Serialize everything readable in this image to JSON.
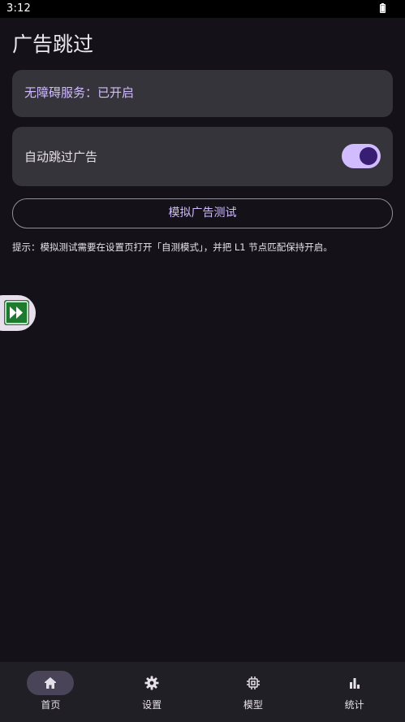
{
  "status_bar": {
    "time": "3:12",
    "battery_icon": "battery-icon"
  },
  "header": {
    "title": "广告跳过"
  },
  "service_card": {
    "text": "无障碍服务：已开启"
  },
  "auto_skip": {
    "label": "自动跳过广告",
    "enabled": true
  },
  "test_button": {
    "label": "模拟广告测试"
  },
  "hint": {
    "text": "提示：模拟测试需要在设置页打开「自测模式」，并把 L1 节点匹配保持开启。"
  },
  "floating_button": {
    "icon": "fast-forward-icon"
  },
  "bottom_nav": {
    "items": [
      {
        "label": "首页",
        "icon": "home-icon",
        "active": true
      },
      {
        "label": "设置",
        "icon": "gear-icon",
        "active": false
      },
      {
        "label": "模型",
        "icon": "chip-icon",
        "active": false
      },
      {
        "label": "统计",
        "icon": "bar-chart-icon",
        "active": false
      }
    ]
  },
  "colors": {
    "background": "#141218",
    "card": "#36343B",
    "accent": "#D0BCFF",
    "switch_thumb": "#381E72",
    "nav_background": "#211F26",
    "nav_indicator": "#4A4458",
    "floating_icon": "#1E7A2E"
  }
}
